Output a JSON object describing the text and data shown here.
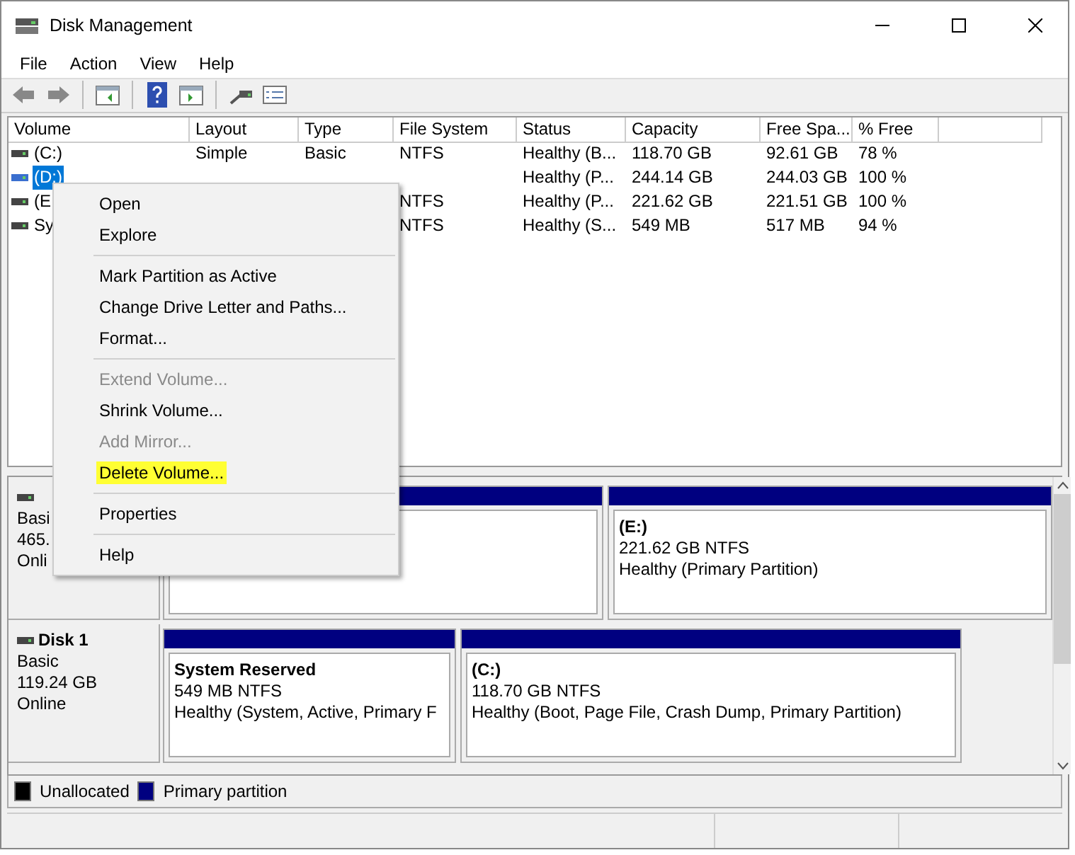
{
  "window": {
    "title": "Disk Management"
  },
  "menu_bar": [
    "File",
    "Action",
    "View",
    "Help"
  ],
  "table": {
    "columns": [
      "Volume",
      "Layout",
      "Type",
      "File System",
      "Status",
      "Capacity",
      "Free Spa...",
      "% Free"
    ],
    "rows": [
      {
        "selected": false,
        "cells": [
          "(C:)",
          "Simple",
          "Basic",
          "NTFS",
          "Healthy (B...",
          "118.70 GB",
          "92.61 GB",
          "78 %"
        ]
      },
      {
        "selected": true,
        "cells": [
          "(D:)",
          null,
          null,
          null,
          "Healthy (P...",
          "244.14 GB",
          "244.03 GB",
          "100 %"
        ]
      },
      {
        "selected": false,
        "cells": [
          "(E",
          null,
          null,
          "NTFS",
          "Healthy (P...",
          "221.62 GB",
          "221.51 GB",
          "100 %"
        ]
      },
      {
        "selected": false,
        "cells": [
          "Sy",
          null,
          null,
          "NTFS",
          "Healthy (S...",
          "549 MB",
          "517 MB",
          "94 %"
        ]
      }
    ]
  },
  "disks": [
    {
      "info": [
        "Basi",
        "465.",
        "Onli"
      ],
      "partitions": [
        {
          "kind": "covered"
        },
        {
          "kind": "volume",
          "name": "(E:)",
          "size": "221.62 GB NTFS",
          "status": "Healthy (Primary Partition)"
        }
      ]
    },
    {
      "name": "Disk 1",
      "info": [
        "Basic",
        "119.24 GB",
        "Online"
      ],
      "partitions": [
        {
          "kind": "volume",
          "name": "System Reserved",
          "size": "549 MB NTFS",
          "status": "Healthy (System, Active, Primary F"
        },
        {
          "kind": "volume",
          "name": "(C:)",
          "size": "118.70 GB NTFS",
          "status": "Healthy (Boot, Page File, Crash Dump, Primary Partition)"
        }
      ]
    }
  ],
  "legend": [
    {
      "label": "Unallocated",
      "color": "#000000"
    },
    {
      "label": "Primary partition",
      "color": "#000080"
    }
  ],
  "context_menu": [
    {
      "kind": "item",
      "label": "Open",
      "disabled": false,
      "highlighted": false
    },
    {
      "kind": "item",
      "label": "Explore",
      "disabled": false,
      "highlighted": false
    },
    {
      "kind": "separator"
    },
    {
      "kind": "item",
      "label": "Mark Partition as Active",
      "disabled": false,
      "highlighted": false
    },
    {
      "kind": "item",
      "label": "Change Drive Letter and Paths...",
      "disabled": false,
      "highlighted": false
    },
    {
      "kind": "item",
      "label": "Format...",
      "disabled": false,
      "highlighted": false
    },
    {
      "kind": "separator"
    },
    {
      "kind": "item",
      "label": "Extend Volume...",
      "disabled": true,
      "highlighted": false
    },
    {
      "kind": "item",
      "label": "Shrink Volume...",
      "disabled": false,
      "highlighted": false
    },
    {
      "kind": "item",
      "label": "Add Mirror...",
      "disabled": true,
      "highlighted": false
    },
    {
      "kind": "item",
      "label": "Delete Volume...",
      "disabled": false,
      "highlighted": true
    },
    {
      "kind": "separator"
    },
    {
      "kind": "item",
      "label": "Properties",
      "disabled": false,
      "highlighted": false
    },
    {
      "kind": "separator"
    },
    {
      "kind": "item",
      "label": "Help",
      "disabled": false,
      "highlighted": false
    }
  ]
}
